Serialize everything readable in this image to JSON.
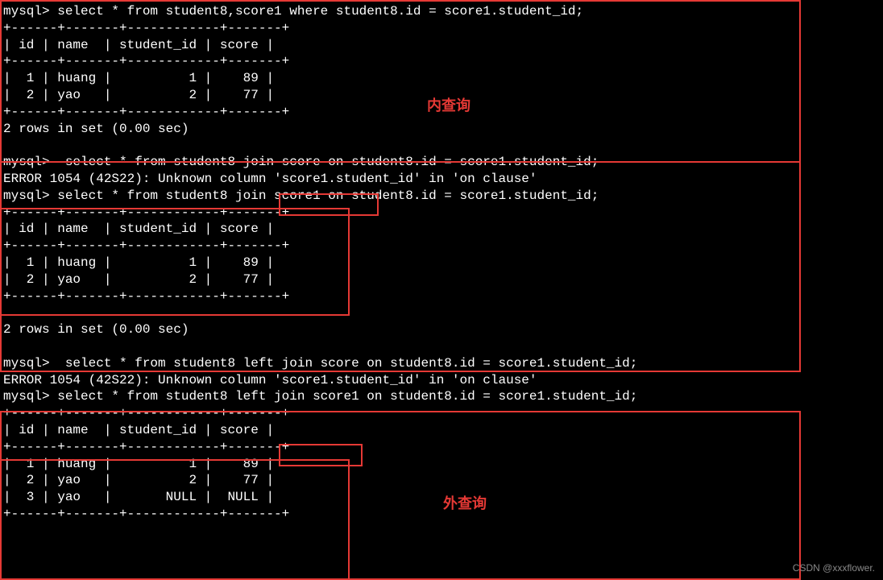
{
  "section1": {
    "prompt1": "mysql> select * from student8,score1 where student8.id = score1.student_id;",
    "hline": "+------+-------+------------+-------+",
    "hdr": "| id | name  | student_id | score |",
    "row1": "|  1 | huang |          1 |    89 |",
    "row2": "|  2 | yao   |          2 |    77 |",
    "result": "2 rows in set (0.00 sec)",
    "label": "内查询"
  },
  "section2": {
    "prompt1": "mysql>  select * from student8 join score on student8.id = score1.student_id;",
    "error": "ERROR 1054 (42S22): Unknown column 'score1.student_id' in 'on clause'",
    "prompt2": "mysql> select * from student8 join score1 on student8.id = score1.student_id;",
    "hline": "+------+-------+------------+-------+",
    "hdr": "| id | name  | student_id | score |",
    "row1": "|  1 | huang |          1 |    89 |",
    "row2": "|  2 | yao   |          2 |    77 |",
    "result": "2 rows in set (0.00 sec)"
  },
  "section3": {
    "prompt1": "mysql>  select * from student8 left join score on student8.id = score1.student_id;",
    "error": "ERROR 1054 (42S22): Unknown column 'score1.student_id' in 'on clause'",
    "prompt2": "mysql> select * from student8 left join score1 on student8.id = score1.student_id;",
    "hline": "+------+-------+------------+-------+",
    "hdr": "| id | name  | student_id | score |",
    "row1": "|  1 | huang |          1 |    89 |",
    "row2": "|  2 | yao   |          2 |    77 |",
    "row3": "|  3 | yao   |       NULL |  NULL |",
    "label": "外查询"
  },
  "watermark": "CSDN @xxxflower."
}
